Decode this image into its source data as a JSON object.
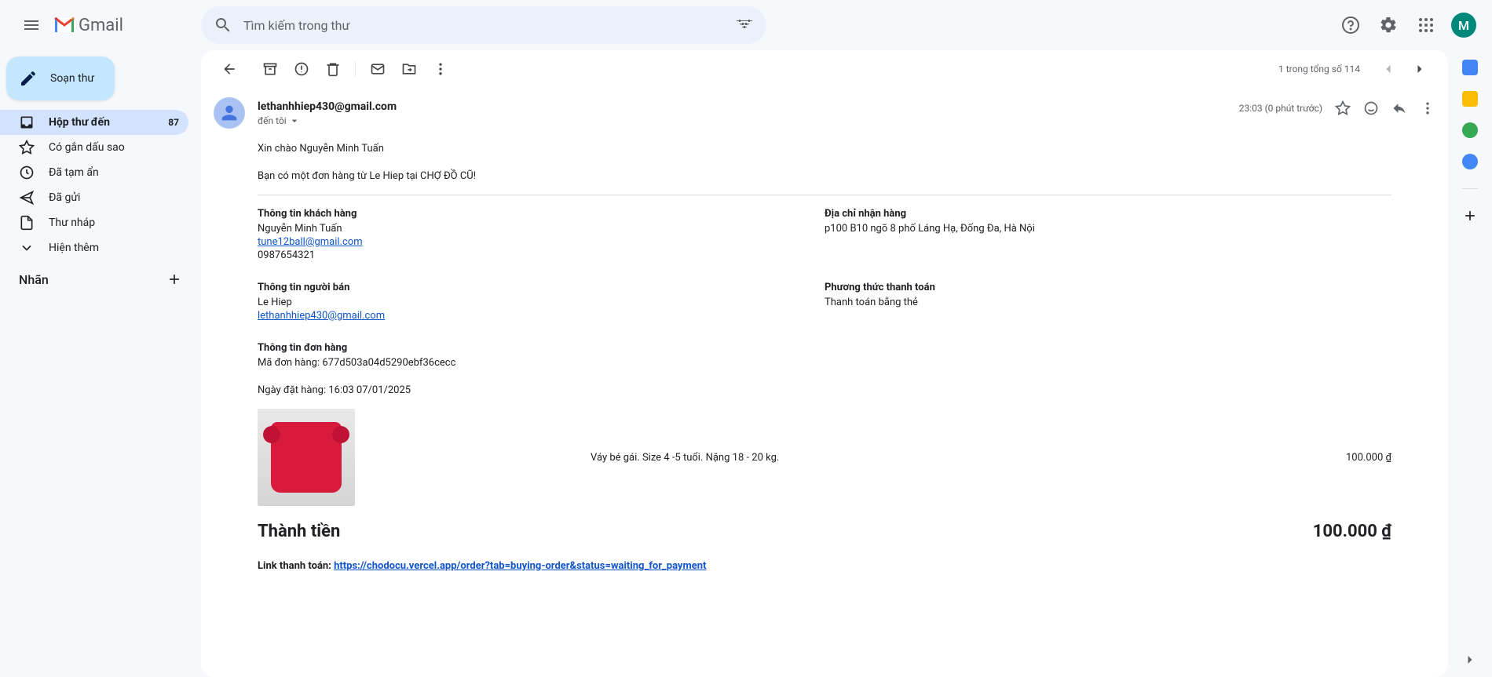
{
  "header": {
    "app_name": "Gmail",
    "search_placeholder": "Tìm kiếm trong thư",
    "avatar_letter": "M"
  },
  "sidebar": {
    "compose_label": "Soạn thư",
    "items": [
      {
        "label": "Hộp thư đến",
        "count": "87"
      },
      {
        "label": "Có gắn dấu sao"
      },
      {
        "label": "Đã tạm ẩn"
      },
      {
        "label": "Đã gửi"
      },
      {
        "label": "Thư nháp"
      },
      {
        "label": "Hiện thêm"
      }
    ],
    "labels_heading": "Nhãn"
  },
  "toolbar": {
    "pager": "1 trong tổng số 114"
  },
  "email": {
    "sender": "lethanhhiep430@gmail.com",
    "recipient_line": "đến tôi",
    "timestamp": "23:03 (0 phút trước)",
    "greeting": "Xin chào Nguyễn Minh Tuấn",
    "intro": "Bạn có một đơn hàng từ Le Hiep tại CHỢ ĐỒ CŨ!",
    "customer": {
      "title": "Thông tin khách hàng",
      "name": "Nguyễn Minh Tuấn",
      "email": "tune12ball@gmail.com",
      "phone": "0987654321"
    },
    "shipping": {
      "title": "Địa chỉ nhận hàng",
      "address": "p100 B10 ngõ 8 phố Láng Hạ, Đống Đa, Hà Nội"
    },
    "seller": {
      "title": "Thông tin người bán",
      "name": "Le Hiep",
      "email": "lethanhhiep430@gmail.com"
    },
    "payment": {
      "title": "Phương thức thanh toán",
      "method": "Thanh toán bằng thẻ"
    },
    "order": {
      "title": "Thông tin đơn hàng",
      "id_line": "Mã đơn hàng: 677d503a04d5290ebf36cecc",
      "date_line": "Ngày đặt hàng: 16:03 07/01/2025",
      "product_desc": "Váy bé gái. Size 4 -5 tuổi. Nặng 18 - 20 kg.",
      "product_price": "100.000 ₫"
    },
    "total": {
      "label": "Thành tiền",
      "value": "100.000 ₫"
    },
    "paylink": {
      "label": "Link thanh toán: ",
      "url": "https://chodocu.vercel.app/order?tab=buying-order&status=waiting_for_payment"
    }
  }
}
